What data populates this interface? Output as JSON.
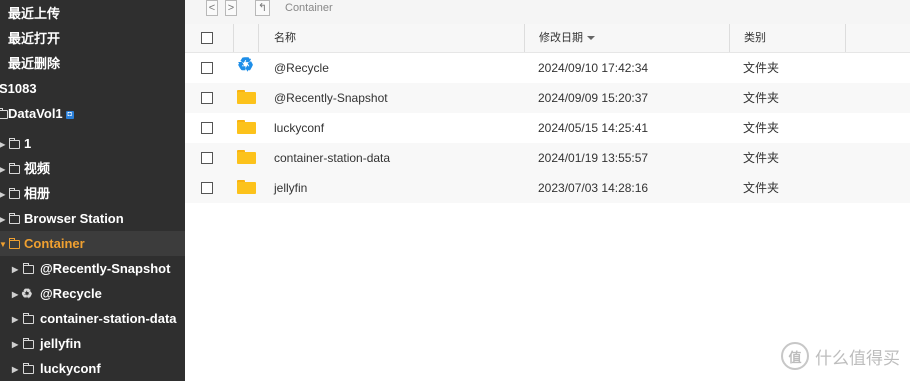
{
  "sidebar": {
    "items": [
      {
        "label": "最近上传"
      },
      {
        "label": "最近打开"
      },
      {
        "label": "最近删除"
      },
      {
        "label": "S1083"
      },
      {
        "label": "DataVol1",
        "badge": "◘"
      },
      {
        "label": "1"
      },
      {
        "label": "视频"
      },
      {
        "label": "相册"
      },
      {
        "label": "Browser Station"
      },
      {
        "label": "Container"
      },
      {
        "label": "@Recently-Snapshot"
      },
      {
        "label": "@Recycle"
      },
      {
        "label": "container-station-data"
      },
      {
        "label": "jellyfin"
      },
      {
        "label": "luckyconf"
      }
    ]
  },
  "toolbar": {
    "back_glyph": "<",
    "forward_glyph": ">",
    "up_glyph": "↰",
    "path": "Container"
  },
  "table": {
    "headers": {
      "name": "名称",
      "modified": "修改日期",
      "type": "类别"
    },
    "sort_column": "modified",
    "rows": [
      {
        "name": "@Recycle",
        "modified": "2024/09/10 17:42:34",
        "type": "文件夹",
        "icon": "recycle-icon"
      },
      {
        "name": "@Recently-Snapshot",
        "modified": "2024/09/09 15:20:37",
        "type": "文件夹",
        "icon": "folder-icon"
      },
      {
        "name": "luckyconf",
        "modified": "2024/05/15 14:25:41",
        "type": "文件夹",
        "icon": "folder-icon"
      },
      {
        "name": "container-station-data",
        "modified": "2024/01/19 13:55:57",
        "type": "文件夹",
        "icon": "folder-icon"
      },
      {
        "name": "jellyfin",
        "modified": "2023/07/03 14:28:16",
        "type": "文件夹",
        "icon": "folder-icon"
      }
    ]
  },
  "watermark": {
    "logo": "值",
    "text": "什么值得买"
  },
  "colors": {
    "sidebar_bg": "#2f2f2f",
    "active_text": "#f0a030",
    "folder": "#fcc21b",
    "recycle": "#1e8ee8"
  }
}
